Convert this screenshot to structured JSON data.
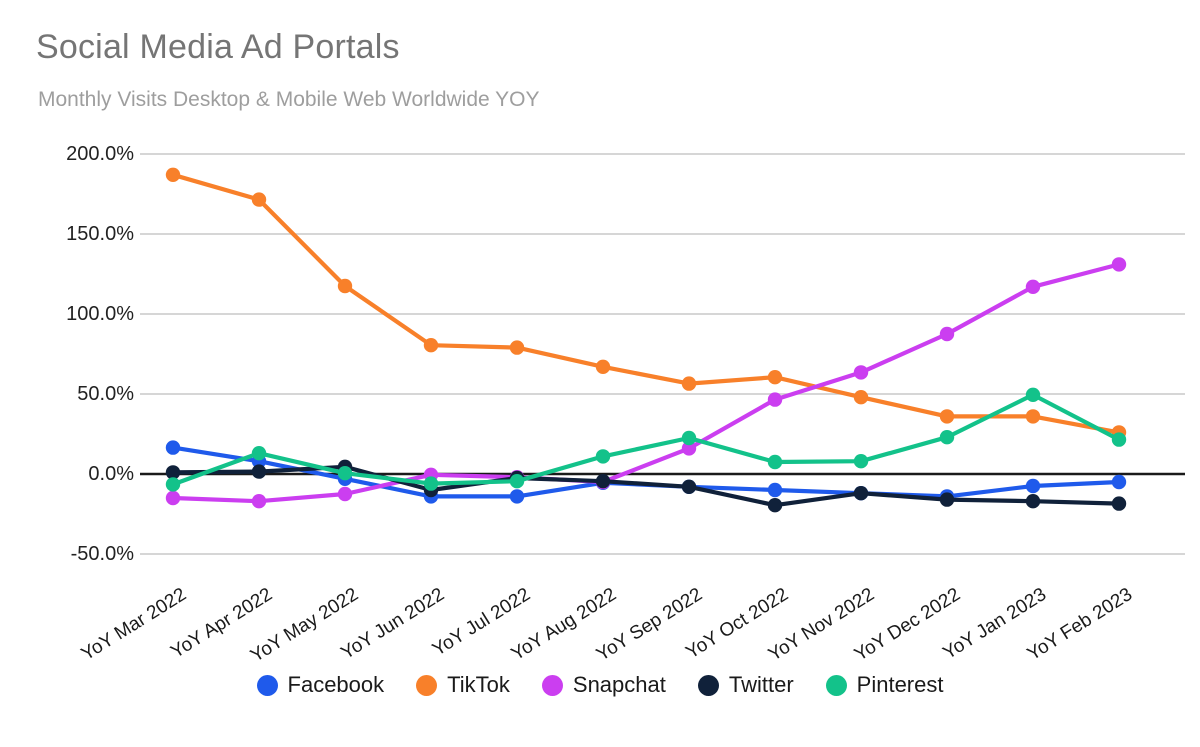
{
  "chart_data": {
    "type": "line",
    "title": "Social Media Ad Portals",
    "subtitle": "Monthly Visits Desktop & Mobile Web Worldwide YOY",
    "xlabel": "",
    "ylabel": "",
    "ylim": [
      -50,
      200
    ],
    "ytick_values": [
      200,
      150,
      100,
      50,
      0,
      -50
    ],
    "ytick_labels": [
      "200.0%",
      "150.0%",
      "100.0%",
      "50.0%",
      "0.0%",
      "-50.0%"
    ],
    "grid": true,
    "zero_line": true,
    "legend_position": "bottom",
    "categories": [
      "YoY Mar 2022",
      "YoY Apr 2022",
      "YoY May 2022",
      "YoY Jun 2022",
      "YoY Jul 2022",
      "YoY Aug 2022",
      "YoY Sep 2022",
      "YoY Oct 2022",
      "YoY Nov 2022",
      "YoY Dec 2022",
      "YoY Jan 2023",
      "YoY Feb 2023"
    ],
    "series": [
      {
        "name": "Facebook",
        "color": "#1f5aeb",
        "values": [
          16.5,
          8.0,
          -3.0,
          -14.0,
          -14.0,
          -5.5,
          -8.0,
          -10.0,
          -12.0,
          -14.0,
          -7.5,
          -5.0
        ]
      },
      {
        "name": "TikTok",
        "color": "#f8802a",
        "values": [
          187.0,
          171.5,
          117.5,
          80.5,
          79.0,
          67.0,
          56.5,
          60.5,
          48.0,
          36.0,
          36.0,
          26.0
        ]
      },
      {
        "name": "Snapchat",
        "color": "#cb3ef0",
        "values": [
          -15.0,
          -17.0,
          -12.5,
          -0.5,
          -2.0,
          -5.0,
          16.0,
          46.5,
          63.5,
          87.5,
          117.0,
          131.0
        ]
      },
      {
        "name": "Twitter",
        "color": "#10213a",
        "values": [
          1.0,
          1.5,
          4.5,
          -10.0,
          -2.5,
          -4.5,
          -8.0,
          -19.5,
          -12.0,
          -16.0,
          -17.0,
          -18.5
        ]
      },
      {
        "name": "Pinterest",
        "color": "#13c28a",
        "values": [
          -6.5,
          13.0,
          0.5,
          -6.0,
          -4.5,
          11.0,
          22.5,
          7.5,
          8.0,
          23.0,
          49.5,
          21.5
        ]
      }
    ]
  },
  "legend": {
    "items": [
      {
        "label": "Facebook",
        "color": "#1f5aeb"
      },
      {
        "label": "TikTok",
        "color": "#f8802a"
      },
      {
        "label": "Snapchat",
        "color": "#cb3ef0"
      },
      {
        "label": "Twitter",
        "color": "#10213a"
      },
      {
        "label": "Pinterest",
        "color": "#13c28a"
      }
    ]
  },
  "colors": {
    "grid": "#c8c8c8",
    "zero_axis": "#1a1a1a",
    "title": "#757575",
    "subtitle": "#9e9e9e",
    "background": "#ffffff"
  }
}
